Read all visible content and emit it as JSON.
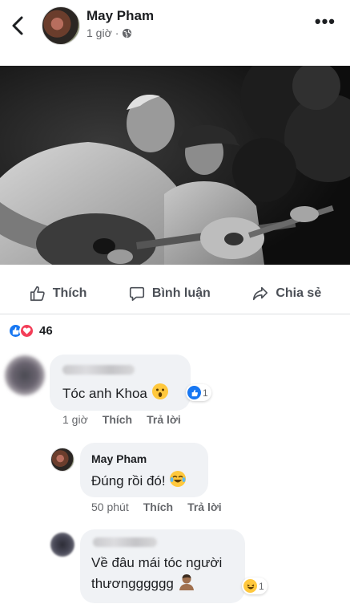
{
  "header": {
    "author": "May Pham",
    "time": "1 giờ",
    "separator": "·"
  },
  "actions": {
    "like": "Thích",
    "comment": "Bình luận",
    "share": "Chia sẻ"
  },
  "reactions": {
    "count": "46"
  },
  "comments": [
    {
      "text": "Tóc anh Khoa",
      "time": "1 giờ",
      "like": "Thích",
      "reply": "Trả lời",
      "reaction_count": "1"
    },
    {
      "name": "May Pham",
      "text": "Đúng rồi đó!",
      "time": "50 phút",
      "like": "Thích",
      "reply": "Trả lời"
    },
    {
      "text_line1": "Về đâu mái tóc người",
      "text_line2": "thươngggggg",
      "reaction_count": "1"
    }
  ],
  "colors": {
    "like_blue": "#1877f2",
    "love_red": "#f33e58",
    "bubble_bg": "#f0f2f5",
    "meta_gray": "#65676b"
  }
}
